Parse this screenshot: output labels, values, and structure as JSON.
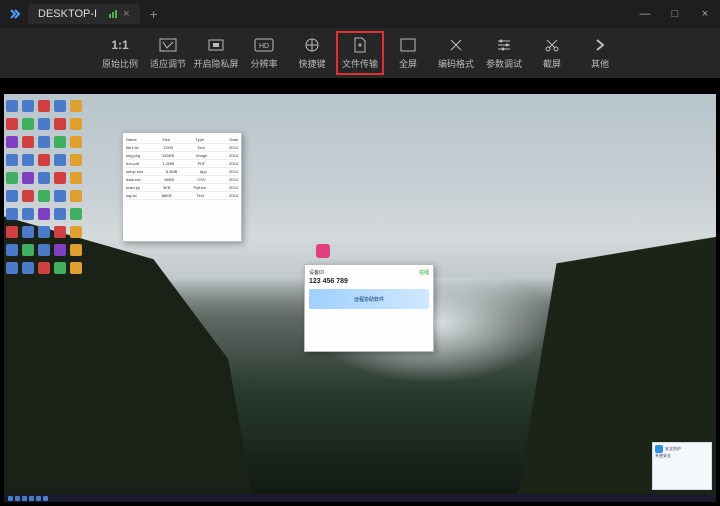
{
  "titlebar": {
    "app_name": "DESKTOP-I",
    "tab_close": "×",
    "new_tab": "+",
    "minimize": "—",
    "maximize": "□",
    "close": "×"
  },
  "toolbar": {
    "items": [
      {
        "icon": "1:1",
        "label": "原始比例"
      },
      {
        "icon": "adapt",
        "label": "适应调节"
      },
      {
        "icon": "privacy",
        "label": "开启隐私屏"
      },
      {
        "icon": "hd",
        "label": "分辨率"
      },
      {
        "icon": "shortcut",
        "label": "快捷键"
      },
      {
        "icon": "file",
        "label": "文件传输"
      },
      {
        "icon": "fullscreen",
        "label": "全屏"
      },
      {
        "icon": "codec",
        "label": "编码格式"
      },
      {
        "icon": "param",
        "label": "参数调试"
      },
      {
        "icon": "screenshot",
        "label": "截屏"
      },
      {
        "icon": "more",
        "label": "其他"
      }
    ],
    "highlighted_index": 5
  },
  "remote": {
    "window1_rows": [
      [
        "Name",
        "Size",
        "Type",
        "Date"
      ],
      [
        "file1.txt",
        "12KB",
        "Text",
        "2024"
      ],
      [
        "img.png",
        "340KB",
        "Image",
        "2024"
      ],
      [
        "doc.pdf",
        "1.2MB",
        "PDF",
        "2024"
      ],
      [
        "setup.exe",
        "8.4MB",
        "App",
        "2024"
      ],
      [
        "data.csv",
        "56KB",
        "CSV",
        "2024"
      ],
      [
        "main.py",
        "3KB",
        "Python",
        "2024"
      ],
      [
        "log.txt",
        "88KB",
        "Text",
        "2024"
      ]
    ],
    "window2": {
      "id_label": "设备ID",
      "id_value": "123 456 789",
      "status": "在线",
      "banner": "远程协助软件"
    },
    "notif_title": "安全防护",
    "notif_body": "系统安全"
  }
}
